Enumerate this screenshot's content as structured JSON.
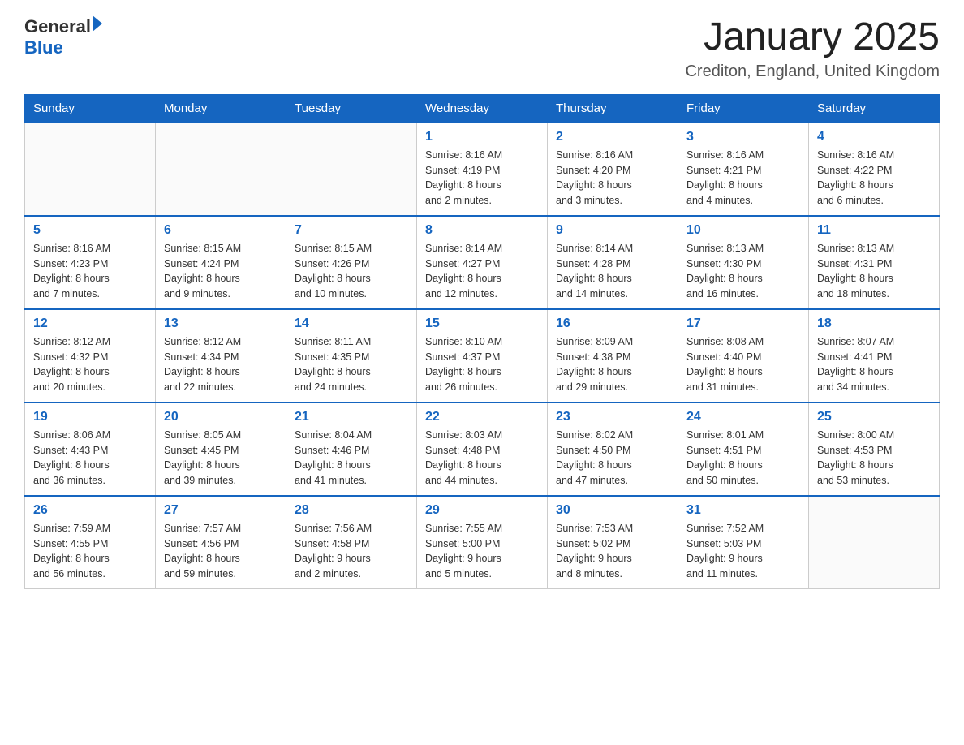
{
  "header": {
    "logo_general": "General",
    "logo_blue": "Blue",
    "title": "January 2025",
    "location": "Crediton, England, United Kingdom"
  },
  "days_of_week": [
    "Sunday",
    "Monday",
    "Tuesday",
    "Wednesday",
    "Thursday",
    "Friday",
    "Saturday"
  ],
  "weeks": [
    [
      {
        "day": "",
        "info": ""
      },
      {
        "day": "",
        "info": ""
      },
      {
        "day": "",
        "info": ""
      },
      {
        "day": "1",
        "info": "Sunrise: 8:16 AM\nSunset: 4:19 PM\nDaylight: 8 hours\nand 2 minutes."
      },
      {
        "day": "2",
        "info": "Sunrise: 8:16 AM\nSunset: 4:20 PM\nDaylight: 8 hours\nand 3 minutes."
      },
      {
        "day": "3",
        "info": "Sunrise: 8:16 AM\nSunset: 4:21 PM\nDaylight: 8 hours\nand 4 minutes."
      },
      {
        "day": "4",
        "info": "Sunrise: 8:16 AM\nSunset: 4:22 PM\nDaylight: 8 hours\nand 6 minutes."
      }
    ],
    [
      {
        "day": "5",
        "info": "Sunrise: 8:16 AM\nSunset: 4:23 PM\nDaylight: 8 hours\nand 7 minutes."
      },
      {
        "day": "6",
        "info": "Sunrise: 8:15 AM\nSunset: 4:24 PM\nDaylight: 8 hours\nand 9 minutes."
      },
      {
        "day": "7",
        "info": "Sunrise: 8:15 AM\nSunset: 4:26 PM\nDaylight: 8 hours\nand 10 minutes."
      },
      {
        "day": "8",
        "info": "Sunrise: 8:14 AM\nSunset: 4:27 PM\nDaylight: 8 hours\nand 12 minutes."
      },
      {
        "day": "9",
        "info": "Sunrise: 8:14 AM\nSunset: 4:28 PM\nDaylight: 8 hours\nand 14 minutes."
      },
      {
        "day": "10",
        "info": "Sunrise: 8:13 AM\nSunset: 4:30 PM\nDaylight: 8 hours\nand 16 minutes."
      },
      {
        "day": "11",
        "info": "Sunrise: 8:13 AM\nSunset: 4:31 PM\nDaylight: 8 hours\nand 18 minutes."
      }
    ],
    [
      {
        "day": "12",
        "info": "Sunrise: 8:12 AM\nSunset: 4:32 PM\nDaylight: 8 hours\nand 20 minutes."
      },
      {
        "day": "13",
        "info": "Sunrise: 8:12 AM\nSunset: 4:34 PM\nDaylight: 8 hours\nand 22 minutes."
      },
      {
        "day": "14",
        "info": "Sunrise: 8:11 AM\nSunset: 4:35 PM\nDaylight: 8 hours\nand 24 minutes."
      },
      {
        "day": "15",
        "info": "Sunrise: 8:10 AM\nSunset: 4:37 PM\nDaylight: 8 hours\nand 26 minutes."
      },
      {
        "day": "16",
        "info": "Sunrise: 8:09 AM\nSunset: 4:38 PM\nDaylight: 8 hours\nand 29 minutes."
      },
      {
        "day": "17",
        "info": "Sunrise: 8:08 AM\nSunset: 4:40 PM\nDaylight: 8 hours\nand 31 minutes."
      },
      {
        "day": "18",
        "info": "Sunrise: 8:07 AM\nSunset: 4:41 PM\nDaylight: 8 hours\nand 34 minutes."
      }
    ],
    [
      {
        "day": "19",
        "info": "Sunrise: 8:06 AM\nSunset: 4:43 PM\nDaylight: 8 hours\nand 36 minutes."
      },
      {
        "day": "20",
        "info": "Sunrise: 8:05 AM\nSunset: 4:45 PM\nDaylight: 8 hours\nand 39 minutes."
      },
      {
        "day": "21",
        "info": "Sunrise: 8:04 AM\nSunset: 4:46 PM\nDaylight: 8 hours\nand 41 minutes."
      },
      {
        "day": "22",
        "info": "Sunrise: 8:03 AM\nSunset: 4:48 PM\nDaylight: 8 hours\nand 44 minutes."
      },
      {
        "day": "23",
        "info": "Sunrise: 8:02 AM\nSunset: 4:50 PM\nDaylight: 8 hours\nand 47 minutes."
      },
      {
        "day": "24",
        "info": "Sunrise: 8:01 AM\nSunset: 4:51 PM\nDaylight: 8 hours\nand 50 minutes."
      },
      {
        "day": "25",
        "info": "Sunrise: 8:00 AM\nSunset: 4:53 PM\nDaylight: 8 hours\nand 53 minutes."
      }
    ],
    [
      {
        "day": "26",
        "info": "Sunrise: 7:59 AM\nSunset: 4:55 PM\nDaylight: 8 hours\nand 56 minutes."
      },
      {
        "day": "27",
        "info": "Sunrise: 7:57 AM\nSunset: 4:56 PM\nDaylight: 8 hours\nand 59 minutes."
      },
      {
        "day": "28",
        "info": "Sunrise: 7:56 AM\nSunset: 4:58 PM\nDaylight: 9 hours\nand 2 minutes."
      },
      {
        "day": "29",
        "info": "Sunrise: 7:55 AM\nSunset: 5:00 PM\nDaylight: 9 hours\nand 5 minutes."
      },
      {
        "day": "30",
        "info": "Sunrise: 7:53 AM\nSunset: 5:02 PM\nDaylight: 9 hours\nand 8 minutes."
      },
      {
        "day": "31",
        "info": "Sunrise: 7:52 AM\nSunset: 5:03 PM\nDaylight: 9 hours\nand 11 minutes."
      },
      {
        "day": "",
        "info": ""
      }
    ]
  ]
}
